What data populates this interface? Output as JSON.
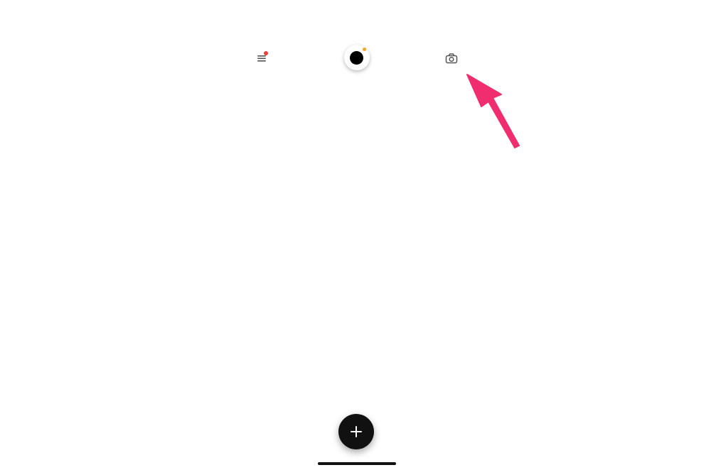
{
  "top_bar": {
    "menu_icon": "hamburger-menu-icon",
    "menu_has_notification": true,
    "avatar_icon": "profile-avatar-icon",
    "avatar_has_status": true,
    "camera_icon": "camera-icon"
  },
  "annotation": {
    "type": "arrow",
    "points_to": "camera-button"
  },
  "fab": {
    "icon": "plus-icon"
  },
  "colors": {
    "background": "#ffffff",
    "icon_gray": "#555555",
    "notification_red": "#e8413c",
    "status_orange": "#f5a623",
    "avatar_black": "#000000",
    "fab_black": "#111111",
    "fab_icon": "#ffffff",
    "arrow_pink": "#f02d6e",
    "home_indicator": "#111111"
  }
}
